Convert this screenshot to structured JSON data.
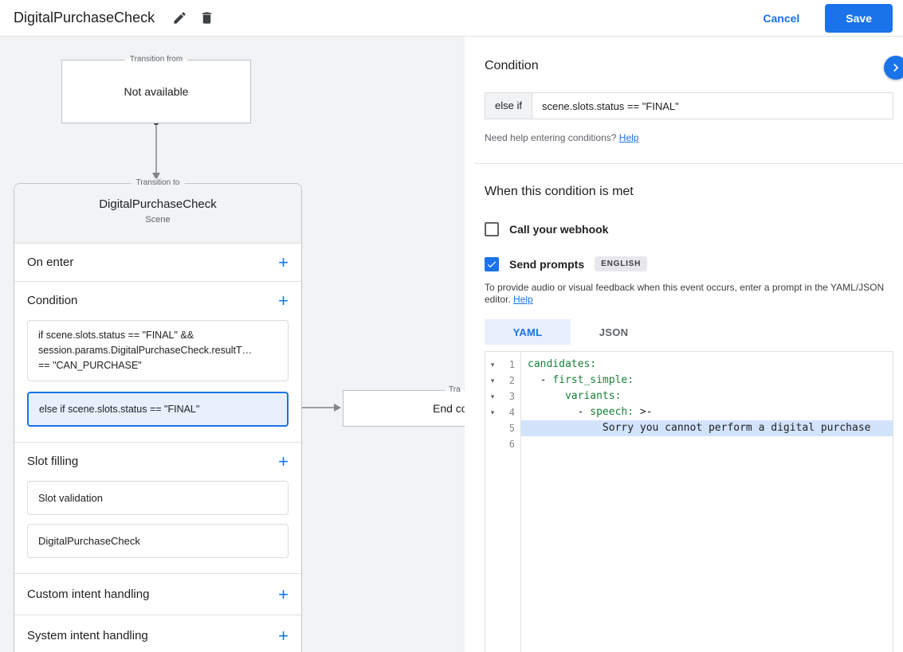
{
  "colors": {
    "accent": "#1a73e8",
    "selected_bg": "#e8f0fe",
    "code_key_green": "#188038",
    "line_highlight": "#d2e3fc",
    "canvas_bg": "#f1f3f4"
  },
  "icons": {
    "add": "+",
    "fold_open": "▾"
  },
  "topbar": {
    "title": "DigitalPurchaseCheck",
    "cancel_label": "Cancel",
    "save_label": "Save"
  },
  "canvas": {
    "transition_from": {
      "label": "Transition from",
      "value": "Not available"
    },
    "scene": {
      "label": "Transition to",
      "title": "DigitalPurchaseCheck",
      "subtitle": "Scene",
      "on_enter_label": "On enter",
      "condition_label": "Condition",
      "conditions": [
        {
          "text": "if scene.slots.status == \"FINAL\" &&\nsession.params.DigitalPurchaseCheck.resultT…\n== \"CAN_PURCHASE\"",
          "selected": false
        },
        {
          "text": "else if scene.slots.status == \"FINAL\"",
          "selected": true
        }
      ],
      "slot_filling_label": "Slot filling",
      "slot_items": [
        "Slot validation",
        "DigitalPurchaseCheck"
      ],
      "custom_intent_label": "Custom intent handling",
      "system_intent_label": "System intent handling"
    },
    "end_node": {
      "label": "Tra",
      "value": "End co"
    }
  },
  "panel": {
    "title": "Condition",
    "condition": {
      "prefix": "else if",
      "value": "scene.slots.status == \"FINAL\""
    },
    "help_prompt": "Need help entering conditions? ",
    "help_link": "Help",
    "when_met_title": "When this condition is met",
    "webhook": {
      "label": "Call your webhook",
      "checked": false
    },
    "prompts": {
      "label": "Send prompts",
      "badge": "ENGLISH",
      "checked": true
    },
    "description": "To provide audio or visual feedback when this event occurs, enter a prompt in the YAML/JSON editor. ",
    "description_help_link": "Help",
    "tabs": [
      {
        "label": "YAML",
        "active": true
      },
      {
        "label": "JSON",
        "active": false
      }
    ],
    "editor": {
      "lines": [
        {
          "num": "1",
          "fold": true,
          "highlight": false,
          "segments": [
            {
              "text": "candidates:",
              "color": "key"
            }
          ]
        },
        {
          "num": "2",
          "fold": true,
          "highlight": false,
          "segments": [
            {
              "text": "  - ",
              "color": "plain"
            },
            {
              "text": "first_simple:",
              "color": "key"
            }
          ]
        },
        {
          "num": "3",
          "fold": true,
          "highlight": false,
          "segments": [
            {
              "text": "      ",
              "color": "plain"
            },
            {
              "text": "variants:",
              "color": "key"
            }
          ]
        },
        {
          "num": "4",
          "fold": true,
          "highlight": false,
          "segments": [
            {
              "text": "        - ",
              "color": "plain"
            },
            {
              "text": "speech:",
              "color": "key"
            },
            {
              "text": " >-",
              "color": "plain"
            }
          ]
        },
        {
          "num": "5",
          "fold": false,
          "highlight": true,
          "segments": [
            {
              "text": "            Sorry you cannot perform a digital purchase",
              "color": "plain"
            }
          ]
        },
        {
          "num": "6",
          "fold": false,
          "highlight": false,
          "segments": []
        }
      ]
    }
  }
}
